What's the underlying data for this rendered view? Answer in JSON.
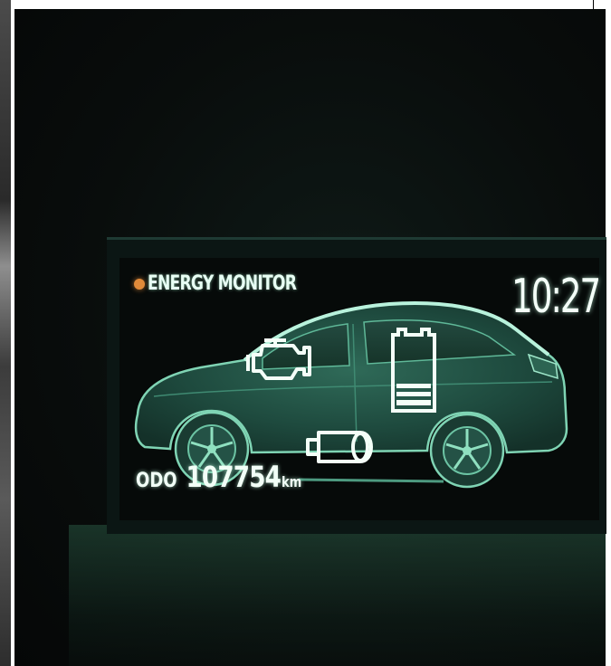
{
  "display": {
    "title": "ENERGY MONITOR",
    "clock": "10:27",
    "odometer_label": "ODO",
    "odometer_value": "107754",
    "odometer_unit": "km"
  },
  "colors": {
    "display_glow": "#8fe0c0",
    "indicator_dot": "#e08a3a",
    "screen_background": "#060a09"
  },
  "icons": [
    "engine-icon",
    "battery-icon",
    "electric-motor-icon"
  ]
}
